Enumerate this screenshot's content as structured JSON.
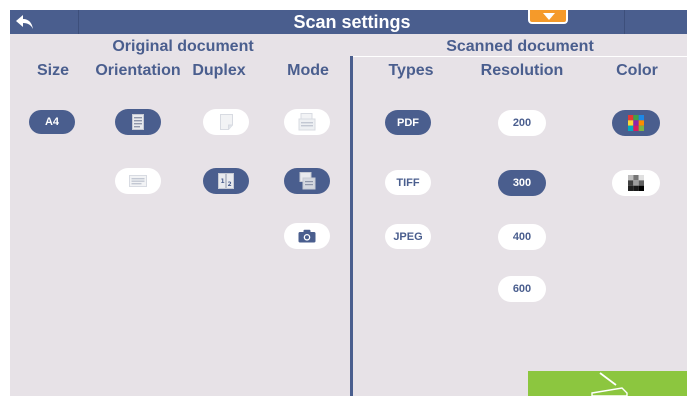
{
  "header": {
    "title": "Scan settings"
  },
  "original": {
    "title": "Original document",
    "columns": {
      "size": "Size",
      "orientation": "Orientation",
      "duplex": "Duplex",
      "mode": "Mode"
    },
    "size_option": "A4"
  },
  "scanned": {
    "title": "Scanned document",
    "columns": {
      "types": "Types",
      "resolution": "Resolution",
      "color": "Color"
    },
    "types": [
      "PDF",
      "TIFF",
      "JPEG"
    ],
    "selected_type": "PDF",
    "resolutions": [
      "200",
      "300",
      "400",
      "600"
    ],
    "selected_resolution": "300"
  },
  "icons": {
    "back": "back-arrow-icon",
    "menu": "chevron-down-icon",
    "portrait": "portrait-page-icon",
    "landscape": "landscape-page-icon",
    "simplex": "single-sided-icon",
    "duplex": "double-sided-icon",
    "feeder": "document-feeder-icon",
    "flatbed": "flatbed-scan-icon",
    "camera": "camera-icon",
    "color": "color-mode-icon",
    "grayscale": "grayscale-mode-icon",
    "start_scan": "scan-start-icon"
  },
  "colors": {
    "accent": "#4a5e8e",
    "background": "#e7e2e7",
    "menu": "#f59a2a",
    "action": "#8cc63f"
  }
}
